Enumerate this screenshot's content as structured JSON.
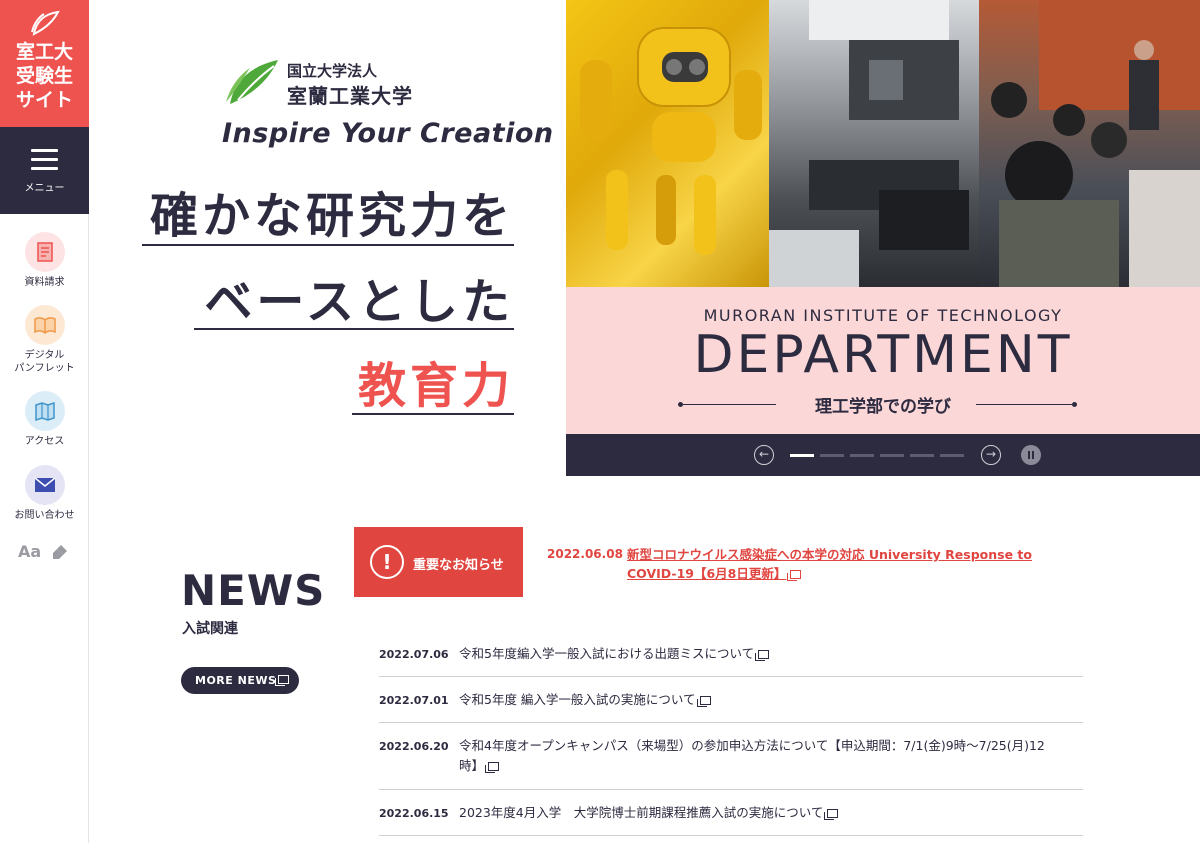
{
  "sidebar": {
    "site_title": "室工大受験生サイト",
    "site_title_lines": [
      "室工大",
      "受験生",
      "サイト"
    ],
    "menu_label": "メニュー",
    "items": [
      {
        "label": "資料請求",
        "icon": "document-icon"
      },
      {
        "label": "デジタル\nパンフレット",
        "icon": "book-icon"
      },
      {
        "label": "アクセス",
        "icon": "map-icon"
      },
      {
        "label": "お問い合わせ",
        "icon": "mail-icon"
      }
    ],
    "font_tool": "Aa",
    "colors": {
      "brand": "#ee5350",
      "navy": "#2d2b40"
    }
  },
  "hero": {
    "logo_line1": "国立大学法人",
    "logo_line2": "室蘭工業大学",
    "tagline": "Inspire Your Creation",
    "catch_line1": "確かな研究力を",
    "catch_line2": "ベースとした",
    "catch_line3": "教育力"
  },
  "slider": {
    "subtitle": "MURORAN  INSTITUTE OF TECHNOLOGY",
    "title": "DEPARTMENT",
    "caption": "理工学部での学び",
    "slide_count": 6,
    "active_slide": 1,
    "prev_icon": "arrow-left-icon",
    "next_icon": "arrow-right-icon",
    "pause_icon": "pause-icon"
  },
  "alert": {
    "label": "重要なお知らせ",
    "icon": "!",
    "date": "2022.06.08",
    "text": "新型コロナウイルス感染症への本学の対応 University Response to COVID-19【6月8日更新】"
  },
  "news": {
    "heading": "NEWS",
    "subheading": "入試関連",
    "more_label": "MORE NEWS",
    "items": [
      {
        "date": "2022.07.06",
        "title": "令和5年度編入学一般入試における出題ミスについて"
      },
      {
        "date": "2022.07.01",
        "title": "令和5年度 編入学一般入試の実施について"
      },
      {
        "date": "2022.06.20",
        "title": "令和4年度オープンキャンパス（来場型）の参加申込方法について【申込期間：7/1(金)9時～7/25(月)12時】"
      },
      {
        "date": "2022.06.15",
        "title": "2023年度4月入学　大学院博士前期課程推薦入試の実施について"
      }
    ]
  }
}
